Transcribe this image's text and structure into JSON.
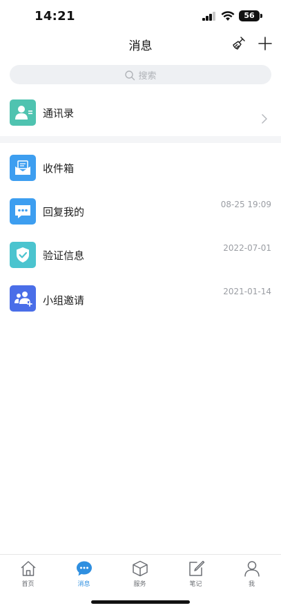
{
  "status_bar": {
    "time": "14:21",
    "battery": "56"
  },
  "nav": {
    "title": "消息"
  },
  "search": {
    "placeholder": "搜索"
  },
  "contacts": {
    "label": "通讯录"
  },
  "messages": [
    {
      "label": "收件箱",
      "time": ""
    },
    {
      "label": "回复我的",
      "time": "08-25 19:09"
    },
    {
      "label": "验证信息",
      "time": "2022-07-01"
    },
    {
      "label": "小组邀请",
      "time": "2021-01-14"
    }
  ],
  "tabs": [
    {
      "label": "首页",
      "icon": "home-icon"
    },
    {
      "label": "消息",
      "icon": "chat-bubble-icon",
      "active": true
    },
    {
      "label": "服务",
      "icon": "box-icon"
    },
    {
      "label": "笔记",
      "icon": "edit-note-icon"
    },
    {
      "label": "我",
      "icon": "person-icon"
    }
  ],
  "colors": {
    "accent": "#2f8fe0",
    "contacts_icon": "#4fc3b0",
    "inbox_icon": "#3d9ef0",
    "reply_icon": "#3d9ef0",
    "verify_icon": "#4bc4cf",
    "group_icon": "#4a6ee8"
  }
}
